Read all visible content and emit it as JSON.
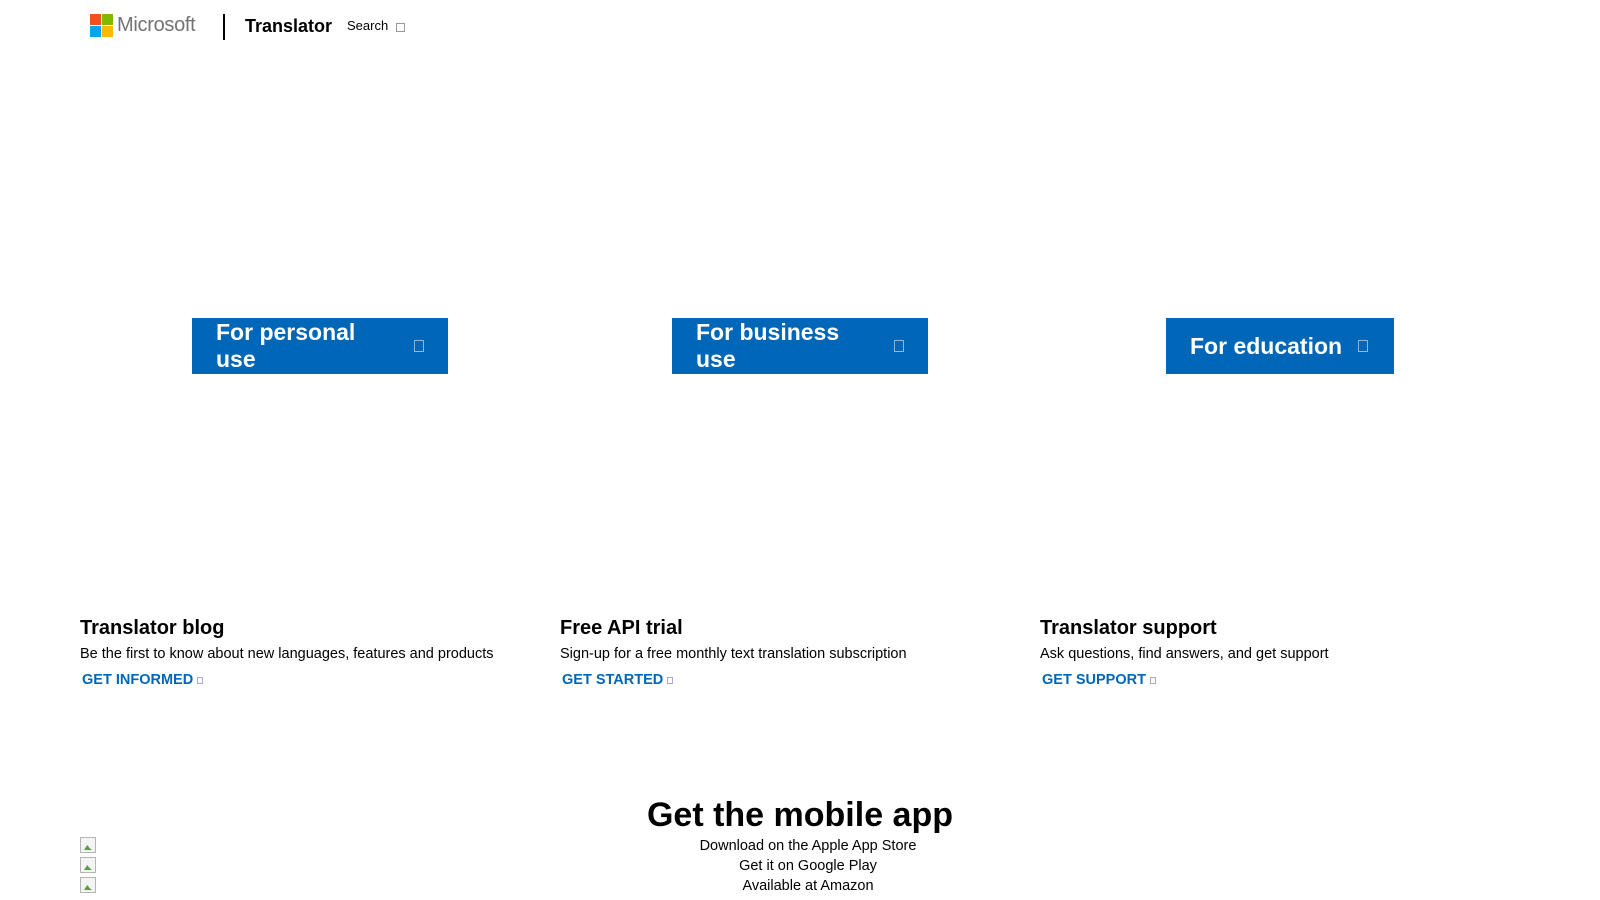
{
  "header": {
    "brand": "Microsoft",
    "product": "Translator",
    "search_label": "Search",
    "logo_colors": [
      "#f25022",
      "#7fba00",
      "#00a4ef",
      "#ffb900"
    ]
  },
  "audience_buttons": [
    {
      "label": "For personal use"
    },
    {
      "label": "For business use"
    },
    {
      "label": "For education"
    }
  ],
  "cards": [
    {
      "title": "Translator blog",
      "description": "Be the first to know about new languages, features and products",
      "link": "GET INFORMED"
    },
    {
      "title": "Free API trial",
      "description": "Sign-up for a free monthly text translation subscription",
      "link": "GET STARTED"
    },
    {
      "title": "Translator support",
      "description": "Ask questions, find answers, and get support",
      "link": "GET SUPPORT"
    }
  ],
  "mobile": {
    "title": "Get the mobile app",
    "stores": [
      {
        "label": "Download on the Apple App Store"
      },
      {
        "label": "Get it on Google Play"
      },
      {
        "label": "Available at Amazon"
      }
    ]
  },
  "colors": {
    "accent": "#0067b8",
    "text": "#000000",
    "background": "#ffffff"
  }
}
